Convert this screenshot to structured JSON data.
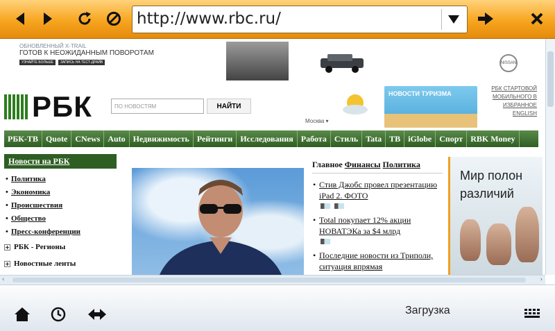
{
  "toolbar": {
    "url": "http://www.rbc.ru/",
    "icons": [
      "back-icon",
      "forward-icon",
      "reload-icon",
      "stop-icon",
      "dropdown-icon",
      "go-icon",
      "close-icon"
    ]
  },
  "banner": {
    "line1": "ОБНОВЛЕННЫЙ X-TRAIL",
    "line2": "ГОТОВ К НЕОЖИДАННЫМ ПОВОРОТАМ",
    "btn1": "УЗНАЙТЕ БОЛЬШЕ",
    "btn2": "ЗАПИСЬ НА ТЕСТ-ДРАЙВ",
    "brand": "NISSAN"
  },
  "header": {
    "logo": "РБК",
    "search_placeholder": "ПО НОВОСТЯМ",
    "search_button": "НАЙТИ",
    "city": "Москва",
    "tour_label": "НОВОСТИ ТУРИЗМА",
    "start_link": "РБК СТАРТОВОЙ МОБИЛЬНОГО В ИЗБРАННОЕ ENGLISH"
  },
  "nav": [
    "РБК-ТВ",
    "Quote",
    "CNews",
    "Auto",
    "Недвижимость",
    "Рейтинги",
    "Исследования",
    "Работа",
    "Стиль",
    "Tata",
    "ТВ",
    "iGlobe",
    "Спорт",
    "RBK Money"
  ],
  "left": {
    "heading": "Новости на РБК",
    "items": [
      "Политика",
      "Экономика",
      "Происшествия",
      "Общество",
      "Пресс-конференции"
    ],
    "expanders": [
      "РБК - Регионы",
      "Новостные ленты"
    ]
  },
  "mid": {
    "tab1": "Главное",
    "tab2": "Финансы",
    "tab3": "Политика",
    "items": [
      "Стив Джобс провел презентацию iPad 2. ФОТО",
      "Total покупает 12% акции НОВАТЭКа за $4 млрд",
      "Последние новости из Триполи, ситуация впрямая"
    ]
  },
  "ad": {
    "text": "Мир полон различий"
  },
  "bottom": {
    "status": "Загрузка"
  }
}
